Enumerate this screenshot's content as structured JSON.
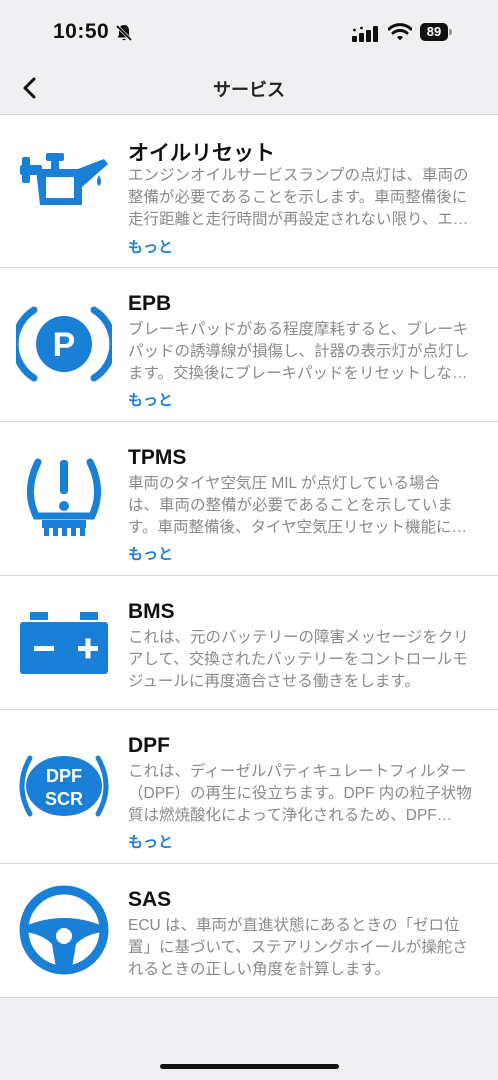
{
  "status_bar": {
    "time": "10:50",
    "battery": "89"
  },
  "nav": {
    "title": "サービス"
  },
  "services": [
    {
      "title": "オイルリセット",
      "icon": "oil-can-icon",
      "lines": [
        "エンジンオイルサービスランプの点灯は、車両の",
        "整備が必要であることを示します。車両整備後に",
        "走行距離と走行時間が再設定されない限り、エ…"
      ],
      "more": "もっと"
    },
    {
      "title": "EPB",
      "icon": "parking-brake-icon",
      "lines": [
        "ブレーキパッドがある程度摩耗すると、ブレーキ",
        "パッドの誘導線が損傷し、計器の表示灯が点灯し",
        "ます。交換後にブレーキパッドをリセットしな…"
      ],
      "more": "もっと"
    },
    {
      "title": "TPMS",
      "icon": "tire-pressure-icon",
      "lines": [
        "車両のタイヤ空気圧 MIL が点灯している場合",
        "は、車両の整備が必要であることを示していま",
        "す。車両整備後、タイヤ空気圧リセット機能に…"
      ],
      "more": "もっと"
    },
    {
      "title": "BMS",
      "icon": "battery-icon",
      "lines": [
        "これは、元のバッテリーの障害メッセージをクリ",
        "アして、交換されたバッテリーをコントロールモ",
        "ジュールに再度適合させる働きをします。"
      ]
    },
    {
      "title": "DPF",
      "icon": "dpf-scr-icon",
      "icon_text": [
        "DPF",
        "SCR"
      ],
      "lines": [
        "これは、ディーゼルパティキュレートフィルター",
        "（DPF）の再生に役立ちます。DPF 内の粒子状物",
        "質は燃焼酸化によって浄化されるため、DPF…"
      ],
      "more": "もっと"
    },
    {
      "title": "SAS",
      "icon": "steering-wheel-icon",
      "lines": [
        "ECU は、車両が直進状態にあるときの「ゼロ位",
        "置」に基づいて、ステアリングホイールが操舵さ",
        "れるときの正しい角度を計算します。"
      ]
    }
  ]
}
